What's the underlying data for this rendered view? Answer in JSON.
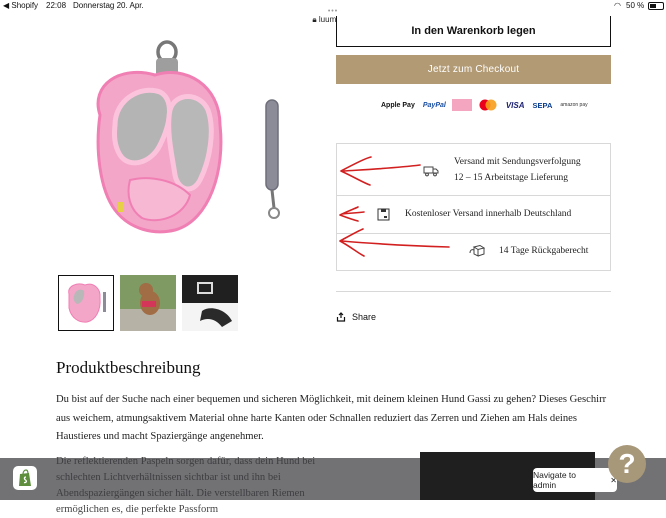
{
  "status_bar": {
    "back_label": "◀ Shopify",
    "time": "22:08",
    "date": "Donnerstag 20. Apr.",
    "battery": "50 %"
  },
  "browser": {
    "url": "luumpi.de"
  },
  "product": {
    "add_to_cart_label": "In den Warenkorb legen",
    "checkout_label": "Jetzt zum Checkout",
    "payment_methods": [
      "Apple Pay",
      "PayPal",
      "Klarna",
      "Mastercard",
      "VISA",
      "SEPA",
      "amazon pay"
    ],
    "info_rows": [
      {
        "icon": "truck-icon",
        "line1": "Versand mit Sendungsverfolgung",
        "line2": "12 – 15 Arbeitstage Lieferung"
      },
      {
        "icon": "box-icon",
        "line1": "Kostenloser Versand innerhalb Deutschland"
      },
      {
        "icon": "return-package-icon",
        "line1": "14 Tage Rückgaberecht"
      }
    ],
    "share_label": "Share"
  },
  "description": {
    "heading": "Produktbeschreibung",
    "paragraph1": "Du bist auf der Suche nach einer bequemen und sicheren Möglichkeit, mit deinem kleinen Hund Gassi zu gehen? Dieses Geschirr aus weichem, atmungsaktivem Material ohne harte Kanten oder Schnallen reduziert das Zerren und Ziehen am Hals deines Haustieres und macht Spaziergänge angenehmer.",
    "paragraph2": "Die reflektierenden Paspeln sorgen dafür, dass dein Hund bei schlechten Lichtverhältnissen sichtbar ist und ihn bei Abendspaziergängen sicher hält. Die verstellbaren Riemen ermöglichen es, die perfekte Passform"
  },
  "overlay": {
    "navigate_label": "Navigate to admin",
    "help_label": "?"
  },
  "colors": {
    "checkout": "#b29a74",
    "annotation": "#d22020",
    "harness_pink": "#f3a6c8",
    "help_button": "#a8987a"
  }
}
